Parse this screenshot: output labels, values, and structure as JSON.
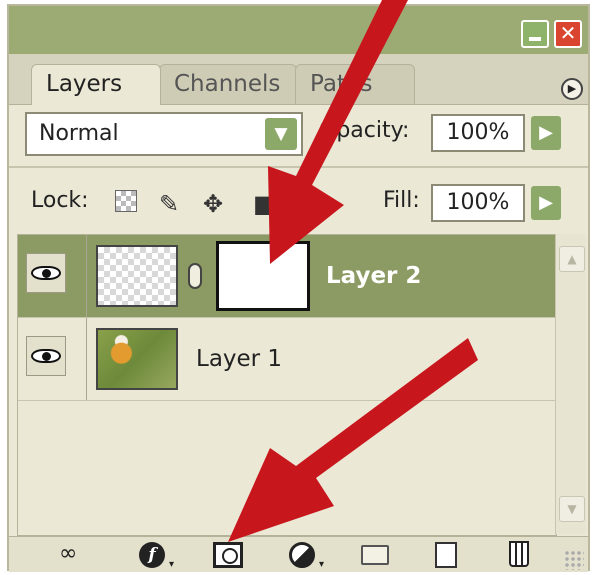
{
  "window": {
    "minimize_icon": "minimize-icon",
    "close_icon": "close-icon",
    "close_glyph": "✕"
  },
  "tabs": [
    {
      "label": "Layers",
      "active": true
    },
    {
      "label": "Channels",
      "active": false
    },
    {
      "label": "Paths",
      "active": false
    }
  ],
  "panel_menu_glyph": "▶",
  "blend_mode": {
    "value": "Normal",
    "arrow_glyph": "▼"
  },
  "opacity": {
    "label": "Opacity:",
    "value": "100%",
    "button_glyph": "▶"
  },
  "lock": {
    "label": "Lock:",
    "icons": [
      "lock-transparent-pixels-icon",
      "brush-icon",
      "move-icon",
      "lock-icon"
    ]
  },
  "fill": {
    "label": "Fill:",
    "value": "100%",
    "button_glyph": "▶"
  },
  "layers": [
    {
      "name": "Layer 2",
      "selected": true,
      "visible": true,
      "has_mask": true
    },
    {
      "name": "Layer 1",
      "selected": false,
      "visible": true,
      "has_mask": false
    }
  ],
  "scrollbar": {
    "up_glyph": "▲",
    "down_glyph": "▼"
  },
  "bottom_toolbar": [
    "link-layers-icon",
    "layer-style-icon",
    "add-layer-mask-icon",
    "adjustment-layer-icon",
    "new-group-icon",
    "new-layer-icon",
    "delete-layer-icon"
  ],
  "annotation_color": "#c8161d",
  "accent_color": "#8c9b64"
}
